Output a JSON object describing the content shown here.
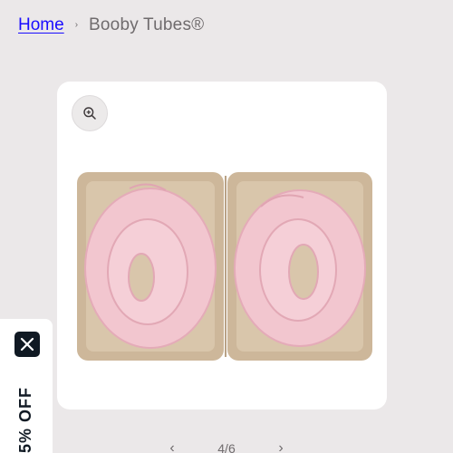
{
  "breadcrumb": {
    "home": "Home",
    "separator": "›",
    "current": "Booby Tubes®"
  },
  "gallery": {
    "zoom_icon": "zoom-in-icon",
    "image_alt": "Two pink Booby Tubes coiled in a kraft paper tray",
    "counter": "4/6",
    "prev_icon": "chevron-left-icon",
    "next_icon": "chevron-right-icon"
  },
  "promo": {
    "close_icon": "close-icon",
    "text": "5% OFF"
  },
  "colors": {
    "background": "#ebe8e9",
    "link": "#1a0dff",
    "promo_dark": "#101923"
  }
}
